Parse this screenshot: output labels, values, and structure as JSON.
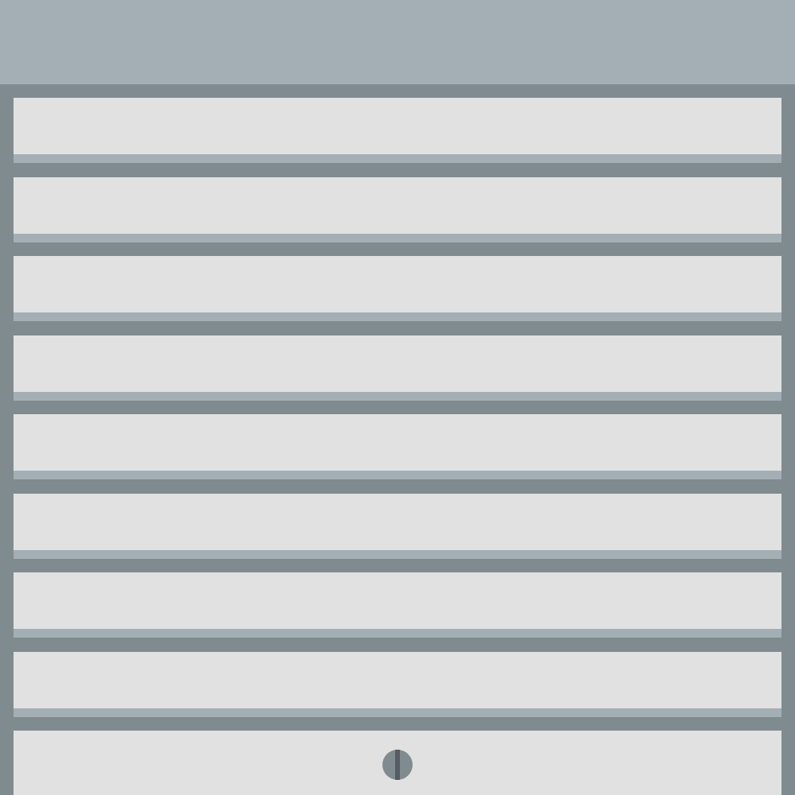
{
  "scene": {
    "subject": "roller-shutter-garage-door",
    "slat_count": 8,
    "has_lock": true
  },
  "colors": {
    "header": "#a4afb5",
    "frame": "#808b90",
    "slat_face": "#e1e1e1",
    "slat_lip": "#a4afb5",
    "lock_body": "#808b90",
    "lock_slot": "#545d62"
  },
  "icons": {
    "lock": "lock-icon"
  }
}
